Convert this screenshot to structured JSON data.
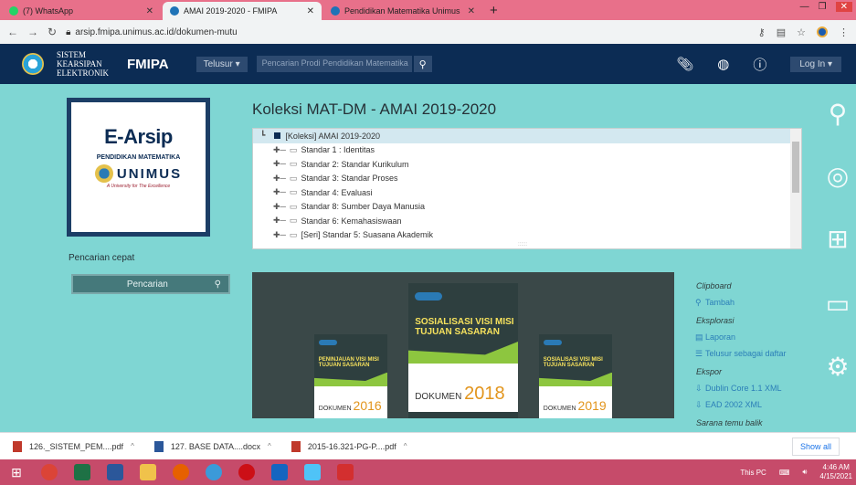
{
  "browser": {
    "tabs": [
      {
        "label": "(7) WhatsApp",
        "color": "#25d366",
        "active": false
      },
      {
        "label": "AMAI 2019-2020 - FMIPA",
        "color": "#1f73b7",
        "active": true
      },
      {
        "label": "Pendidikan Matematika Unimus",
        "color": "#1f73b7",
        "active": false
      }
    ],
    "new_tab": "+",
    "url": "arsip.fmipa.unimus.ac.id/dokumen-mutu"
  },
  "header": {
    "site_line1": "SISTEM",
    "site_line2": "KEARSIPAN",
    "site_line3": "ELEKTRONIK",
    "faculty": "FMIPA",
    "browse": "Telusur",
    "search_placeholder": "Pencarian Prodi Pendidikan Matematika",
    "login": "Log In"
  },
  "left": {
    "brand_title": "E-Arsip",
    "brand_sub": "PENDIDIKAN MATEMATIKA",
    "brand_univ": "UNIMUS",
    "brand_tag": "A University for The Excellence",
    "quick_label": "Pencarian cepat",
    "quick_button": "Pencarian"
  },
  "main": {
    "title": "Koleksi MAT-DM - AMAI 2019-2020",
    "tree_root": "[Koleksi] AMAI 2019-2020",
    "tree_items": [
      "Standar 1 : Identitas",
      "Standar 2: Standar Kurikulum",
      "Standar 3: Standar Proses",
      "Standar 4: Evaluasi",
      "Standar 8: Sumber Daya Manusia",
      "Standar 6: Kemahasiswaan",
      "[Seri] Standar 5: Suasana Akademik"
    ],
    "books": [
      {
        "title": "SOSIALISASI VISI MISI TUJUAN SASARAN",
        "doc": "DOKUMEN",
        "year": "2018"
      },
      {
        "title": "PENINJAUAN VISI MISI TUJUAN SASARAN",
        "doc": "DOKUMEN",
        "year": "2016"
      },
      {
        "title": "SOSIALISASI VISI MISI TUJUAN SASARAN",
        "doc": "DOKUMEN",
        "year": "2019"
      }
    ]
  },
  "sidebar": {
    "clipboard": "Clipboard",
    "add": "Tambah",
    "explore": "Eksplorasi",
    "report": "Laporan",
    "browse_list": "Telusur sebagai daftar",
    "export": "Ekspor",
    "dublin": "Dublin Core 1.1 XML",
    "ead": "EAD 2002 XML",
    "reverse": "Sarana temu balik"
  },
  "downloads": {
    "items": [
      "126._SISTEM_PEM....pdf",
      "127. BASE DATA....docx",
      "2015-16.321-PG-P....pdf"
    ],
    "show_all": "Show all"
  },
  "taskbar": {
    "this_pc": "This PC",
    "time": "4:46 AM",
    "date": "4/15/2021"
  }
}
